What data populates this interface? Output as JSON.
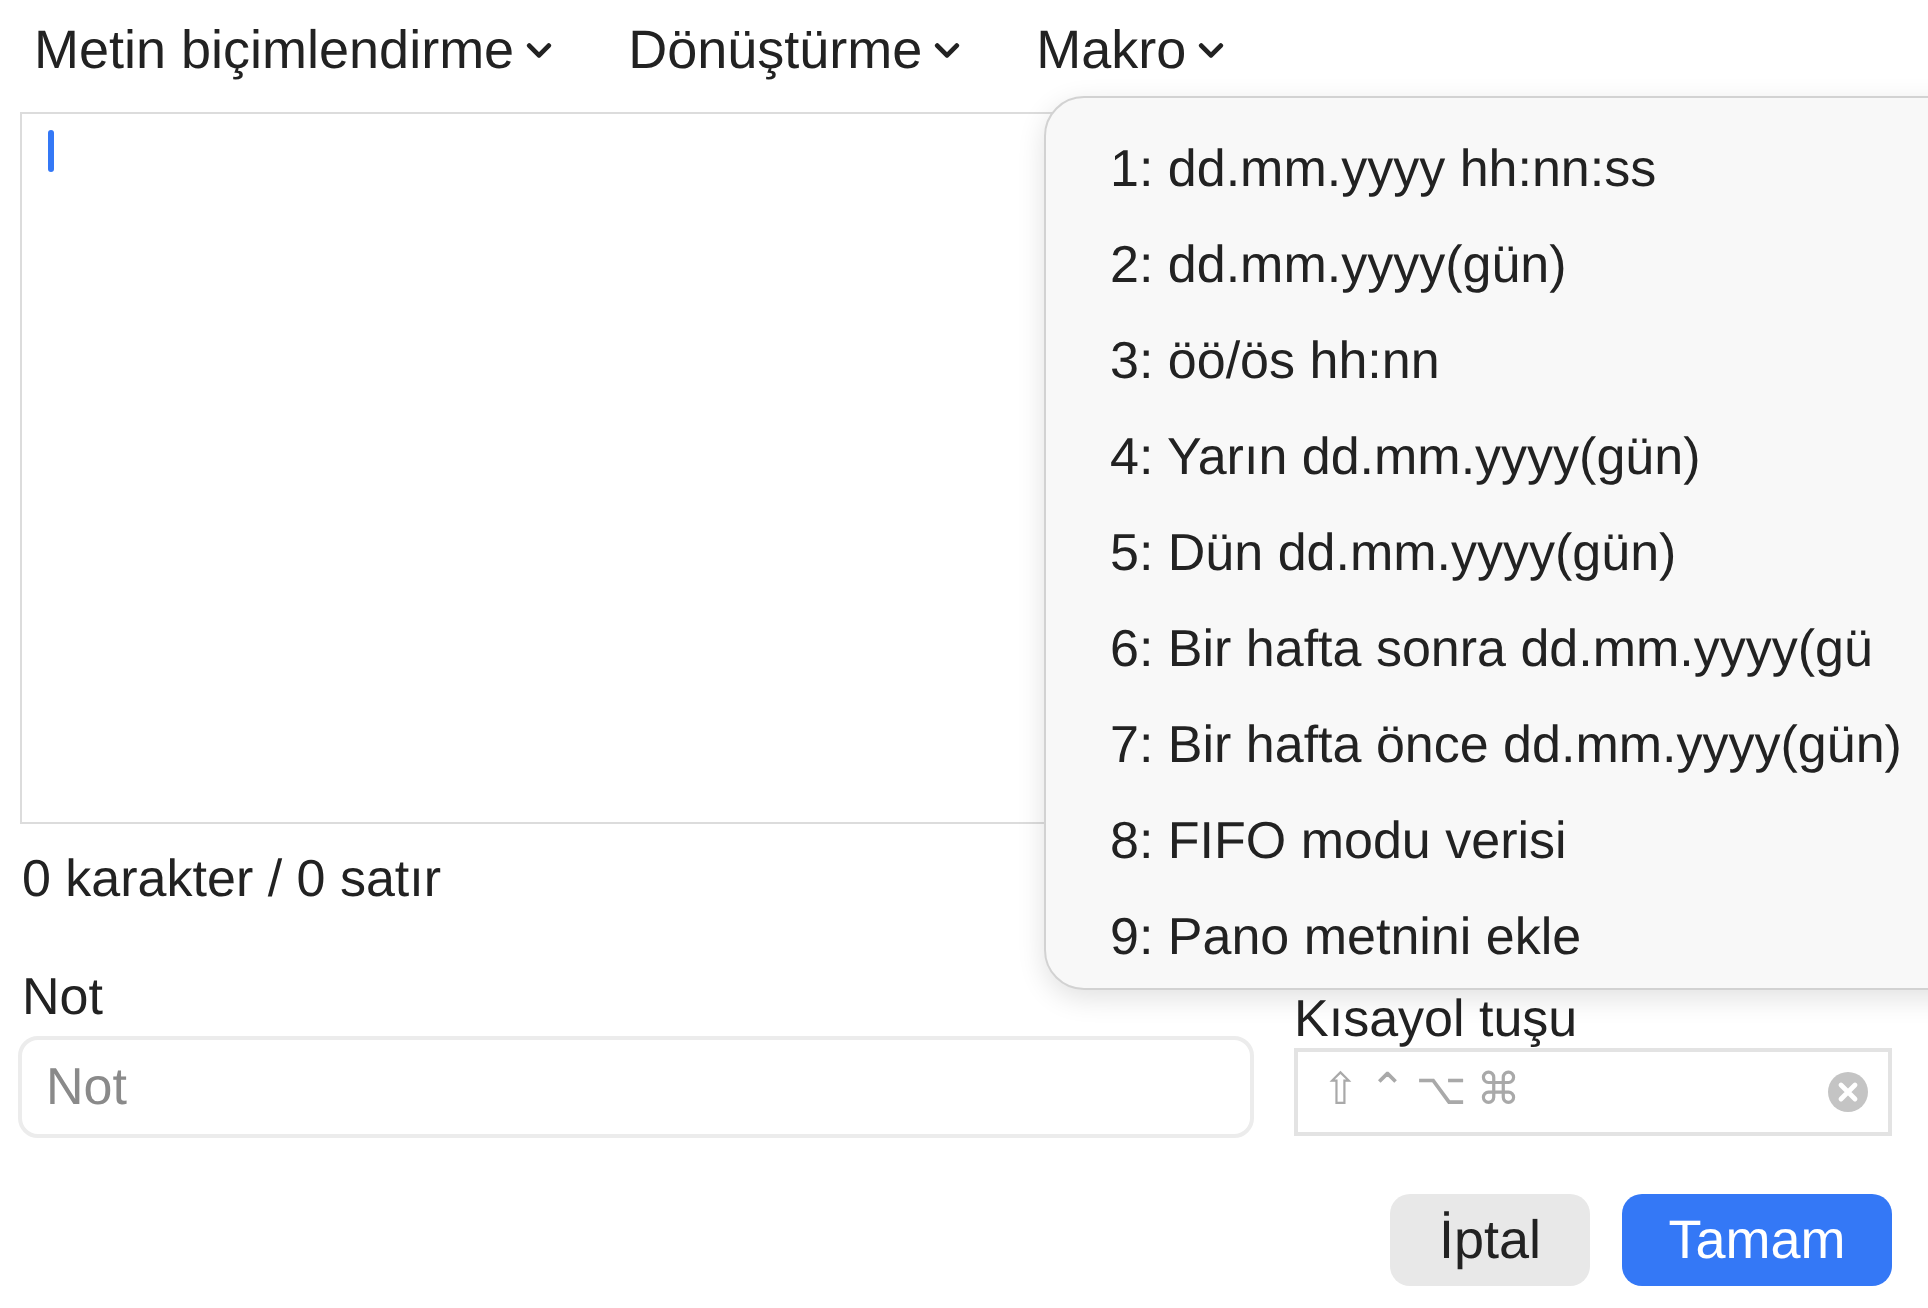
{
  "menu_bar": [
    {
      "label": "Metin biçimlendirme"
    },
    {
      "label": "Dönüştürme"
    },
    {
      "label": "Makro"
    }
  ],
  "editor": {
    "focused": true
  },
  "counter": "0 karakter / 0 satır",
  "note": {
    "label": "Not",
    "placeholder": "Not"
  },
  "shortcut": {
    "label": "Kısayol tuşu",
    "modifier_keys": [
      "⇧",
      "⌃",
      "⌥",
      "⌘"
    ]
  },
  "buttons": [
    {
      "label": "İptal",
      "kind": "secondary"
    },
    {
      "label": "Tamam",
      "kind": "primary"
    }
  ],
  "macro_menu": {
    "items": [
      {
        "label": "1: dd.mm.yyyy hh:nn:ss"
      },
      {
        "label": "2: dd.mm.yyyy(gün)"
      },
      {
        "label": "3: öö/ös hh:nn"
      },
      {
        "label": "4: Yarın dd.mm.yyyy(gün)"
      },
      {
        "label": "5: Dün dd.mm.yyyy(gün)"
      },
      {
        "label": "6: Bir hafta sonra dd.mm.yyyy(gü"
      },
      {
        "label": "7: Bir hafta önce dd.mm.yyyy(gün)"
      },
      {
        "label": "8: FIFO modu verisi"
      },
      {
        "label": "9: Pano metnini ekle"
      }
    ]
  }
}
